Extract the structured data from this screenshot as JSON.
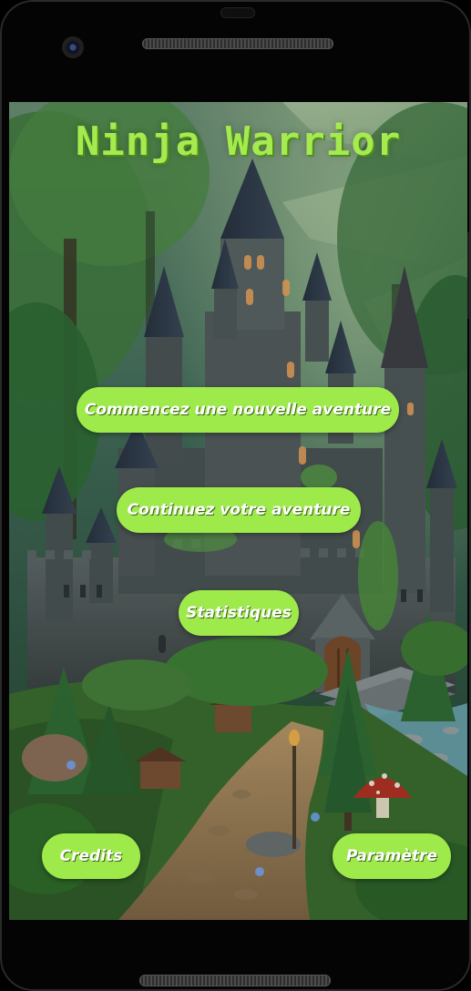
{
  "app": {
    "title": "Ninja Warrior"
  },
  "menu": {
    "new_adventure_label": "Commencez une nouvelle aventure",
    "continue_label": "Continuez votre aventure",
    "stats_label": "Statistiques"
  },
  "footer": {
    "credits_label": "Credits",
    "settings_label": "Paramètre"
  },
  "theme": {
    "button_color": "#9fea4b",
    "title_color": "#a5ea4f",
    "device_color": "#040404"
  },
  "background": {
    "scene_icon": "castle-forest-illustration"
  }
}
